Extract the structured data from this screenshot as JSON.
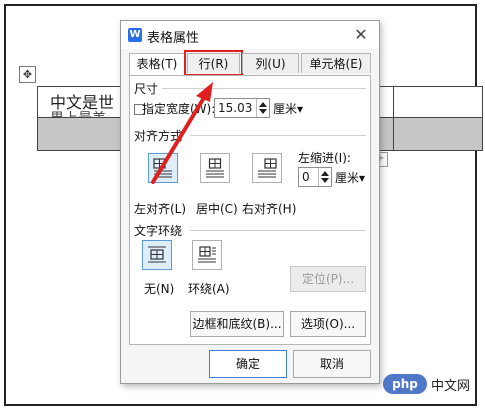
{
  "document": {
    "move_handle_glyph": "✥",
    "cell_text": "中文是世",
    "cell_text_clipped": "界上最美",
    "plus_glyph": "+"
  },
  "dialog": {
    "app_icon_letter": "W",
    "title": "表格属性",
    "close_glyph": "✕",
    "tabs": [
      {
        "label": "表格(T)",
        "active": true
      },
      {
        "label": "行(R)",
        "active": false,
        "highlighted": true
      },
      {
        "label": "列(U)",
        "active": false
      },
      {
        "label": "单元格(E)",
        "active": false
      }
    ],
    "size_section": {
      "title": "尺寸",
      "width_label": "指定宽度(W):",
      "width_checked": true,
      "width_value": "15.03",
      "width_unit": "厘米▾"
    },
    "align_section": {
      "title": "对齐方式",
      "options": [
        {
          "label": "左对齐(L)",
          "selected": true,
          "icon": "align-left-icon"
        },
        {
          "label": "居中(C)",
          "selected": false,
          "icon": "align-center-icon"
        },
        {
          "label": "右对齐(H)",
          "selected": false,
          "icon": "align-right-icon"
        }
      ],
      "indent_label": "左缩进(I):",
      "indent_value": "0",
      "indent_unit": "厘米▾"
    },
    "wrap_section": {
      "title": "文字环绕",
      "options": [
        {
          "label": "无(N)",
          "selected": true,
          "icon": "wrap-none-icon"
        },
        {
          "label": "环绕(A)",
          "selected": false,
          "icon": "wrap-around-icon"
        }
      ],
      "position_button": "定位(P)..."
    },
    "borders_button": "边框和底纹(B)...",
    "options_button": "选项(O)...",
    "ok_button": "确定",
    "cancel_button": "取消"
  },
  "annotation": {
    "color": "#e02020"
  },
  "watermark": {
    "badge": "php",
    "text": "中文网"
  }
}
